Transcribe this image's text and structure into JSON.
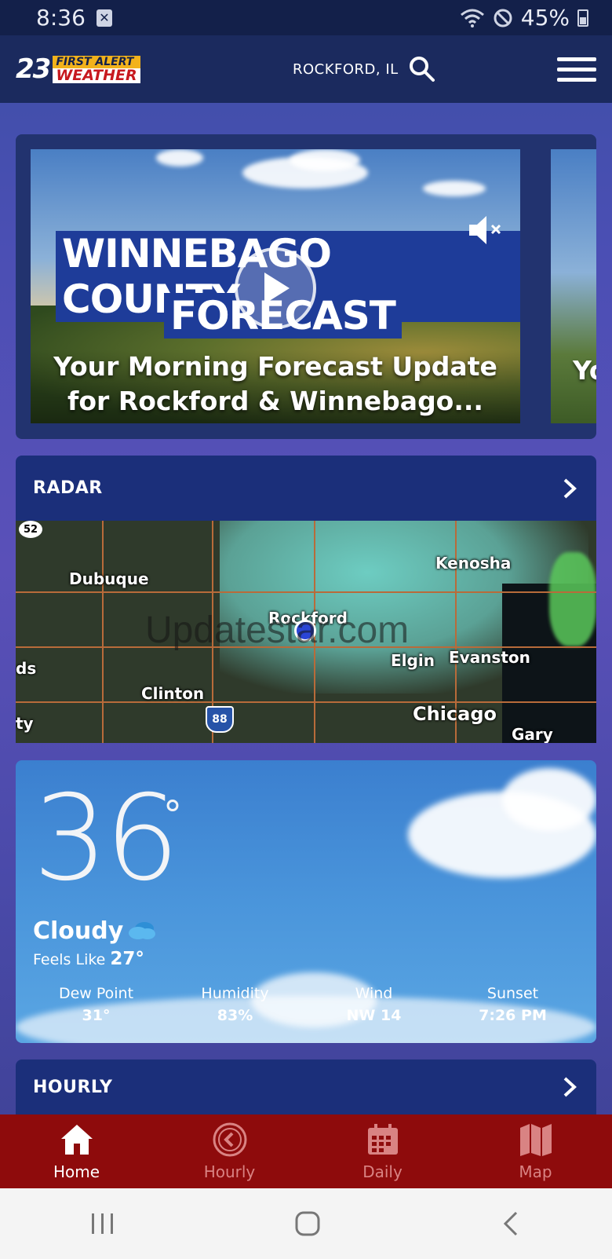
{
  "status_bar": {
    "time": "8:36",
    "battery": "45%"
  },
  "header": {
    "location": "ROCKFORD, IL",
    "logo_number": "23",
    "logo_top": "FIRST ALERT",
    "logo_bottom": "WEATHER"
  },
  "video": {
    "title_line1": "WINNEBAGO COUNTY",
    "title_line2": "FORECAST",
    "caption": "Your Morning Forecast Update for Rockford & Winnebago...",
    "next_caption_peek": "Yo"
  },
  "radar": {
    "title": "RADAR",
    "cities": [
      "Dubuque",
      "Rockford",
      "Kenosha",
      "Elgin",
      "Evanston",
      "Clinton",
      "Chicago",
      "Gary"
    ],
    "route_52": "52",
    "route_88": "88",
    "watermark": "Updatestar.com",
    "edge_text_1": "ds",
    "edge_text_2": "ty"
  },
  "current": {
    "temperature": "36",
    "degree_symbol": "°",
    "condition": "Cloudy",
    "feels_like_label": "Feels Like",
    "feels_like_value": "27°",
    "stats": [
      {
        "label": "Dew Point",
        "value": "31°"
      },
      {
        "label": "Humidity",
        "value": "83%"
      },
      {
        "label": "Wind",
        "value": "NW 14"
      },
      {
        "label": "Sunset",
        "value": "7:26 PM"
      }
    ]
  },
  "hourly": {
    "title": "HOURLY"
  },
  "bottom_nav": {
    "items": [
      {
        "label": "Home",
        "icon": "home-icon",
        "active": true
      },
      {
        "label": "Hourly",
        "icon": "clock-icon",
        "active": false
      },
      {
        "label": "Daily",
        "icon": "calendar-icon",
        "active": false
      },
      {
        "label": "Map",
        "icon": "map-icon",
        "active": false
      }
    ]
  },
  "colors": {
    "header_bg": "#1b2a5e",
    "nav_bg": "#8e0b0c",
    "section_bg": "#1b2f7a"
  }
}
